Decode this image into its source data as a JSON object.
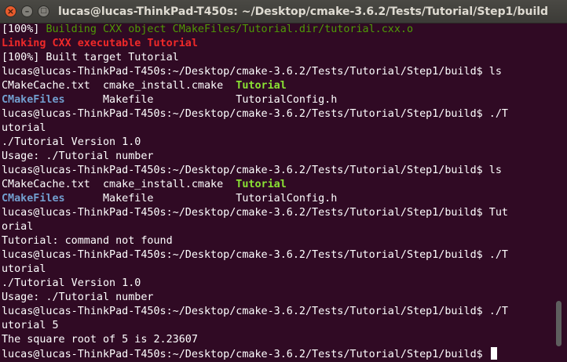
{
  "window": {
    "title": "lucas@lucas-ThinkPad-T450s: ~/Desktop/cmake-3.6.2/Tests/Tutorial/Step1/build"
  },
  "terminal": {
    "lines": [
      [
        {
          "t": "[100%] "
        },
        {
          "t": "Building CXX object CMakeFiles/Tutorial.dir/tutorial.cxx.o",
          "c": "green"
        }
      ],
      [
        {
          "t": "Linking CXX executable Tutorial",
          "c": "redbold"
        }
      ],
      [
        {
          "t": "[100%] Built target Tutorial"
        }
      ],
      [
        {
          "t": "lucas@lucas-ThinkPad-T450s:~/Desktop/cmake-3.6.2/Tests/Tutorial/Step1/build$ ls"
        }
      ],
      [
        {
          "t": "CMakeCache.txt  cmake_install.cmake  "
        },
        {
          "t": "Tutorial",
          "c": "boldgreen"
        }
      ],
      [
        {
          "t": "CMakeFiles",
          "c": "boldblue"
        },
        {
          "t": "      Makefile             TutorialConfig.h"
        }
      ],
      [
        {
          "t": "lucas@lucas-ThinkPad-T450s:~/Desktop/cmake-3.6.2/Tests/Tutorial/Step1/build$ ./T"
        }
      ],
      [
        {
          "t": "utorial"
        }
      ],
      [
        {
          "t": "./Tutorial Version 1.0"
        }
      ],
      [
        {
          "t": "Usage: ./Tutorial number"
        }
      ],
      [
        {
          "t": "lucas@lucas-ThinkPad-T450s:~/Desktop/cmake-3.6.2/Tests/Tutorial/Step1/build$ ls"
        }
      ],
      [
        {
          "t": "CMakeCache.txt  cmake_install.cmake  "
        },
        {
          "t": "Tutorial",
          "c": "boldgreen"
        }
      ],
      [
        {
          "t": "CMakeFiles",
          "c": "boldblue"
        },
        {
          "t": "      Makefile             TutorialConfig.h"
        }
      ],
      [
        {
          "t": "lucas@lucas-ThinkPad-T450s:~/Desktop/cmake-3.6.2/Tests/Tutorial/Step1/build$ Tut"
        }
      ],
      [
        {
          "t": "orial"
        }
      ],
      [
        {
          "t": "Tutorial: command not found"
        }
      ],
      [
        {
          "t": "lucas@lucas-ThinkPad-T450s:~/Desktop/cmake-3.6.2/Tests/Tutorial/Step1/build$ ./T"
        }
      ],
      [
        {
          "t": "utorial"
        }
      ],
      [
        {
          "t": "./Tutorial Version 1.0"
        }
      ],
      [
        {
          "t": "Usage: ./Tutorial number"
        }
      ],
      [
        {
          "t": "lucas@lucas-ThinkPad-T450s:~/Desktop/cmake-3.6.2/Tests/Tutorial/Step1/build$ ./T"
        }
      ],
      [
        {
          "t": "utorial 5"
        }
      ],
      [
        {
          "t": "The square root of 5 is 2.23607"
        }
      ],
      [
        {
          "t": "lucas@lucas-ThinkPad-T450s:~/Desktop/cmake-3.6.2/Tests/Tutorial/Step1/build$ "
        }
      ]
    ]
  },
  "colors": {
    "background": "#300a24",
    "text": "#ffffff",
    "green": "#4e9a06",
    "red": "#ef2929",
    "bold_green": "#8ae234",
    "bold_blue": "#729fcf"
  },
  "icons": {
    "close": "close-icon",
    "minimize": "minimize-icon",
    "maximize": "maximize-icon"
  }
}
